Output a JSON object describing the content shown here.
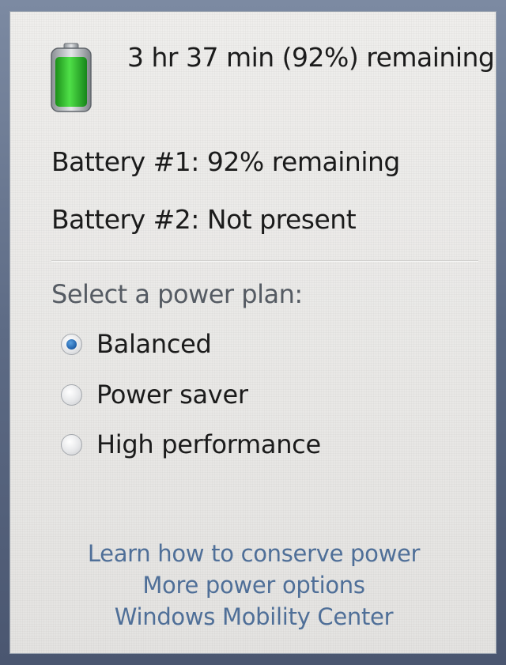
{
  "battery": {
    "summary": "3 hr 37 min (92%) remaining",
    "charge_fraction": 0.92,
    "icon": "battery-icon",
    "fill_color": "#2fbf2a"
  },
  "batteries": [
    {
      "label": "Battery #1: 92% remaining"
    },
    {
      "label": "Battery #2: Not present"
    }
  ],
  "power_plan": {
    "heading": "Select a power plan:",
    "selected": "Balanced",
    "options": [
      {
        "label": "Balanced",
        "checked": true
      },
      {
        "label": "Power saver",
        "checked": false
      },
      {
        "label": "High performance",
        "checked": false
      }
    ]
  },
  "links": [
    {
      "label": "Learn how to conserve power"
    },
    {
      "label": "More power options"
    },
    {
      "label": "Windows Mobility Center"
    }
  ],
  "colors": {
    "link": "#4f6f98",
    "accent_radio": "#1f5fa8",
    "background": "#ebeae8"
  }
}
